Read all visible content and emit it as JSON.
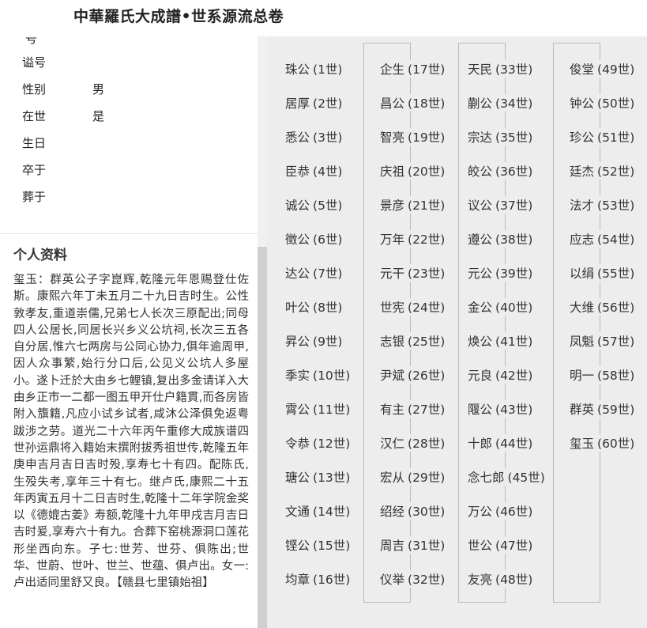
{
  "header": {
    "title": "中華羅氏大成譜•世系源流总卷"
  },
  "profile_fields": [
    {
      "label": "谥号",
      "value": ""
    },
    {
      "label": "性别",
      "value": "男"
    },
    {
      "label": "在世",
      "value": "是"
    },
    {
      "label": "生日",
      "value": ""
    },
    {
      "label": "卒于",
      "value": ""
    },
    {
      "label": "葬于",
      "value": ""
    }
  ],
  "cut_text": "号",
  "section": {
    "title": "个人资料"
  },
  "bio": "玺玉：群英公子字崑辉,乾隆元年恩赐登仕佐斯。康熙六年丁未五月二十九日吉时生。公性敦孝友,重道崇儒,兄弟七人长次三原配出;同母四人公居长,同居长兴乡义公坑祠,长次三五各自分居,惟六七两房与公同心协力,俱年逾周甲,因人众事繁,始行分口后,公见义公坑人多屋小。遂卜迁於大由乡七鲤镇,复出多金请详入大由乡正市一二都一图五甲开仕户籍貫,而各房皆附入籏籍,凡应小试乡试者,咸沐公泽俱免返粤跋涉之劳。道光二十六年丙午重修大成族谱四世孙运鼎将入籍始末撰附拔秀祖世传,乾隆五年庚申吉月吉日吉时殁,享寿七十有四。配陈氏,生殁失考,享年三十有七。继卢氏,康熙二十五年丙寅五月十二日吉时生,乾隆十二年学院金奖以《德媲古姜》寿额,乾隆十九年甲戌吉月吉日吉时爰,享寿六十有九。合葬下窑桃源洞口莲花形坐西向东。子七:世芳、世芬、俱陈出;世华、世蔚、世叶、世兰、世蕴、俱卢出。女一:卢出适同里舒又良。【赣县七里镇始祖】",
  "lineage": {
    "columns": [
      [
        {
          "name": "珠公",
          "gen": "(1世)"
        },
        {
          "name": "居厚",
          "gen": "(2世)"
        },
        {
          "name": "悉公",
          "gen": "(3世)"
        },
        {
          "name": "臣恭",
          "gen": "(4世)"
        },
        {
          "name": "诚公",
          "gen": "(5世)"
        },
        {
          "name": "徵公",
          "gen": "(6世)"
        },
        {
          "name": "达公",
          "gen": "(7世)"
        },
        {
          "name": "叶公",
          "gen": "(8世)"
        },
        {
          "name": "昇公",
          "gen": "(9世)"
        },
        {
          "name": "季实",
          "gen": "(10世)"
        },
        {
          "name": "霄公",
          "gen": "(11世)"
        },
        {
          "name": "令恭",
          "gen": "(12世)"
        },
        {
          "name": "瑭公",
          "gen": "(13世)"
        },
        {
          "name": "文通",
          "gen": "(14世)"
        },
        {
          "name": "铿公",
          "gen": "(15世)"
        },
        {
          "name": "均章",
          "gen": "(16世)"
        }
      ],
      [
        {
          "name": "企生",
          "gen": "(17世)"
        },
        {
          "name": "昌公",
          "gen": "(18世)"
        },
        {
          "name": "智亮",
          "gen": "(19世)"
        },
        {
          "name": "庆祖",
          "gen": "(20世)"
        },
        {
          "name": "景彦",
          "gen": "(21世)"
        },
        {
          "name": "万年",
          "gen": "(22世)"
        },
        {
          "name": "元干",
          "gen": "(23世)"
        },
        {
          "name": "世宪",
          "gen": "(24世)"
        },
        {
          "name": "志银",
          "gen": "(25世)"
        },
        {
          "name": "尹斌",
          "gen": "(26世)"
        },
        {
          "name": "有主",
          "gen": "(27世)"
        },
        {
          "name": "汉仁",
          "gen": "(28世)"
        },
        {
          "name": "宏从",
          "gen": "(29世)"
        },
        {
          "name": "绍经",
          "gen": "(30世)"
        },
        {
          "name": "周吉",
          "gen": "(31世)"
        },
        {
          "name": "仪举",
          "gen": "(32世)"
        }
      ],
      [
        {
          "name": "天民",
          "gen": "(33世)"
        },
        {
          "name": "蒯公",
          "gen": "(34世)"
        },
        {
          "name": "宗达",
          "gen": "(35世)"
        },
        {
          "name": "皎公",
          "gen": "(36世)"
        },
        {
          "name": "议公",
          "gen": "(37世)"
        },
        {
          "name": "遵公",
          "gen": "(38世)"
        },
        {
          "name": "元公",
          "gen": "(39世)"
        },
        {
          "name": "金公",
          "gen": "(40世)"
        },
        {
          "name": "焕公",
          "gen": "(41世)"
        },
        {
          "name": "元良",
          "gen": "(42世)"
        },
        {
          "name": "隁公",
          "gen": "(43世)"
        },
        {
          "name": "十郎",
          "gen": "(44世)"
        },
        {
          "name": "念七郎",
          "gen": "(45世)"
        },
        {
          "name": "万公",
          "gen": "(46世)"
        },
        {
          "name": "世公",
          "gen": "(47世)"
        },
        {
          "name": "友亮",
          "gen": "(48世)"
        }
      ],
      [
        {
          "name": "俊堂",
          "gen": "(49世)"
        },
        {
          "name": "钟公",
          "gen": "(50世)"
        },
        {
          "name": "珍公",
          "gen": "(51世)"
        },
        {
          "name": "廷杰",
          "gen": "(52世)"
        },
        {
          "name": "法才",
          "gen": "(53世)"
        },
        {
          "name": "应志",
          "gen": "(54世)"
        },
        {
          "name": "以绢",
          "gen": "(55世)"
        },
        {
          "name": "大维",
          "gen": "(56世)"
        },
        {
          "name": "凤魁",
          "gen": "(57世)"
        },
        {
          "name": "明一",
          "gen": "(58世)"
        },
        {
          "name": "群英",
          "gen": "(59世)"
        },
        {
          "name": "玺玉",
          "gen": "(60世)"
        }
      ]
    ]
  }
}
